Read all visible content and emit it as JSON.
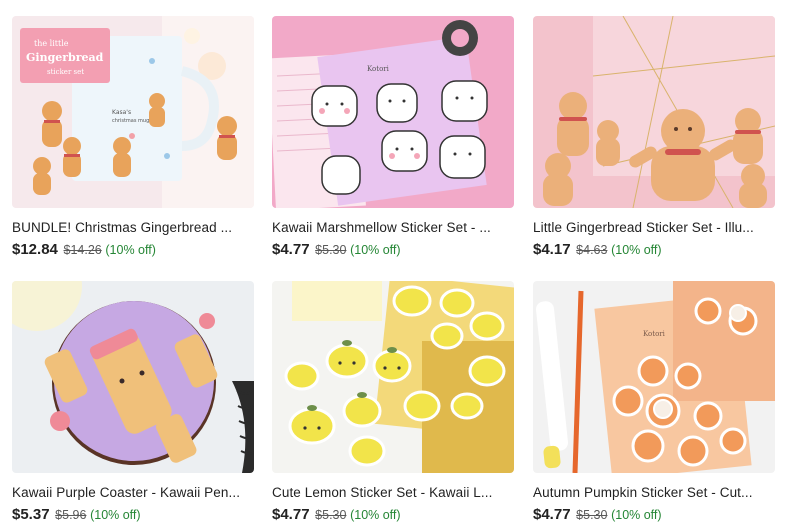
{
  "listings": [
    {
      "title": "BUNDLE! Christmas Gingerbread ...",
      "price": "$12.84",
      "original_price": "$14.26",
      "discount": "(10% off)",
      "image_text": [
        "the little",
        "Gingerbread",
        "sticker set",
        "Kasa's",
        "christmas mug"
      ]
    },
    {
      "title": "Kawaii Marshmellow Sticker Set - ...",
      "price": "$4.77",
      "original_price": "$5.30",
      "discount": "(10% off)",
      "image_text": [
        "Kotori"
      ]
    },
    {
      "title": "Little Gingerbread Sticker Set - Illu...",
      "price": "$4.17",
      "original_price": "$4.63",
      "discount": "(10% off)"
    },
    {
      "title": "Kawaii Purple Coaster - Kawaii Pen...",
      "price": "$5.37",
      "original_price": "$5.96",
      "discount": "(10% off)"
    },
    {
      "title": "Cute Lemon Sticker Set - Kawaii L...",
      "price": "$4.77",
      "original_price": "$5.30",
      "discount": "(10% off)"
    },
    {
      "title": "Autumn Pumpkin Sticker Set - Cut...",
      "price": "$4.77",
      "original_price": "$5.30",
      "discount": "(10% off)",
      "image_text": [
        "Kotori"
      ]
    }
  ],
  "colors": {
    "sale_green": "#258635",
    "strike_gray": "#595959",
    "text": "#222222"
  }
}
